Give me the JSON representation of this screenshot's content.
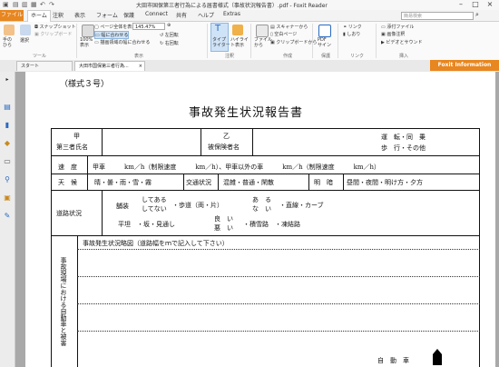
{
  "window": {
    "title": "大田市国保第三者行為による届書様式（事故状況報告書）.pdf - Foxit Reader"
  },
  "menu": {
    "items": [
      "ファイル",
      "ホーム",
      "注釈",
      "表示",
      "フォーム",
      "保護",
      "Connect",
      "共有",
      "ヘルプ",
      "Extras"
    ],
    "search_placeholder": "簡易検索"
  },
  "ribbon": {
    "hand_tool": "手の\nひら",
    "select": "選択",
    "snapshot": "スナップショット",
    "clipboard": "クリップボード",
    "group_tools": "ツール",
    "actual_size": "100%\n表示",
    "fit_page": "ページ全体を表示",
    "fit_width": "幅に合わせる",
    "fit_visible": "描画領域の幅に合わせる",
    "zoom_value": "145.47%",
    "rotate_left": "左回転",
    "rotate_right": "右回転",
    "group_view": "表示",
    "typewriter": "タイプ\nライター",
    "highlight": "ハイライ\nト表示",
    "group_comment": "注釈",
    "file_from": "ファイル\nから",
    "scanner": "スキャナーから",
    "blank_page": "空白ページ",
    "from_clipboard": "クリップボードから",
    "group_create": "作成",
    "pdf_sign": "PDF\nサイン",
    "group_protect": "保護",
    "link": "リンク",
    "bookmark": "しおり",
    "group_link": "リンク",
    "attach_file": "添付ファイル",
    "image": "画像注釈",
    "video_sound": "ビデオとサウンド",
    "group_insert": "挿入"
  },
  "tabs": {
    "start": "スタート",
    "doc": "大田市国保第三者行為...",
    "foxit_info": "Foxit Information"
  },
  "document": {
    "form_no": "（様式３号）",
    "title": "事故発生状況報告書",
    "party_a": "甲",
    "third_party_name": "第三者氏名",
    "party_b": "乙",
    "insured_name": "被保険者名",
    "driving": "運　転・同　乗",
    "walking": "歩　行・その他",
    "speed_label": "速　度",
    "speed_text": "甲車　　　km／h（制限速度　　　km／h）、甲車以外の車　　　km／h（制限速度　　　km／h）",
    "weather_label": "天　候",
    "weather_values": "晴・曇・雨・雪・霧",
    "traffic_label": "交通状況",
    "traffic_values": "混雑・普通・閑散",
    "brightness_label": "明　暗",
    "brightness_values": "昼間・夜間・明け方・夕方",
    "road_label": "道路状況",
    "paved": "舗装",
    "paved_yes": "してある",
    "paved_no": "してない",
    "sidewalk": "・歩道（両・片）",
    "exists": "あ　る",
    "not_exists": "な　い",
    "straight_curve": "・直線・カーブ",
    "flat_slope": "平坦　・坂・見通し",
    "good": "良　い",
    "bad": "悪　い",
    "snow_freeze": "・積雪路　・凍結路",
    "sketch_label": "事故発生状況略図（道路幅をｍで記入して下さい）",
    "vertical_label": "事故現場における自動車と被害",
    "car_label": "自　動　車"
  }
}
